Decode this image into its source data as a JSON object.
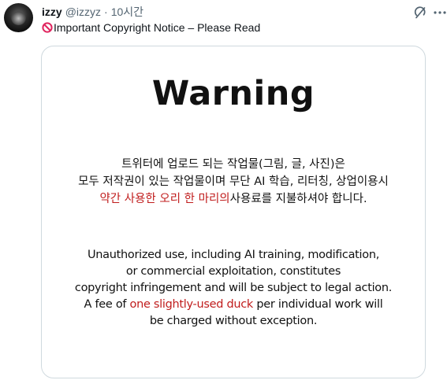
{
  "tweet": {
    "display_name": "izzy",
    "handle": "@izzyz",
    "separator": "·",
    "time": "10시간",
    "text": "Important Copyright Notice – Please Read"
  },
  "image": {
    "title": "Warning",
    "korean": {
      "line1": "트위터에 업로드 되는 작업물(그림, 글, 사진)은",
      "line2": "모두 저작권이 있는 작업물이며 무단 AI 학습, 리터칭, 상업이용시",
      "line3_red": "약간 사용한 오리 한 마리의",
      "line3_rest": "사용료를 지불하셔야 합니다."
    },
    "english": {
      "line1": "Unauthorized use, including AI training, modification,",
      "line2": "or commercial exploitation, constitutes",
      "line3": "copyright infringement and will be subject to legal action.",
      "line4_pre": "A fee of ",
      "line4_red": "one slightly-used duck",
      "line4_post": " per individual work will",
      "line5": "be charged without exception."
    }
  },
  "icons": {
    "prohibited": "prohibited-icon",
    "grok": "grok-icon",
    "more": "more-icon"
  },
  "colors": {
    "text_primary": "#0f1419",
    "text_secondary": "#536471",
    "accent_red": "#c01c1c",
    "border": "#cfd9de"
  }
}
